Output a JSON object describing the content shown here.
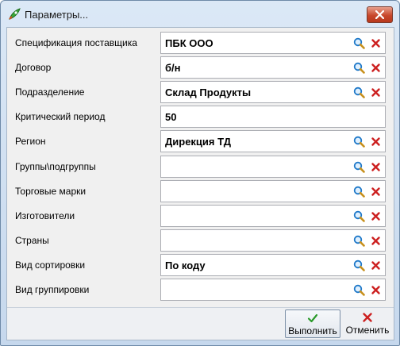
{
  "window": {
    "title": "Параметры...",
    "app_icon": "rocket-app-icon",
    "close_icon": "close-icon"
  },
  "params": [
    {
      "label": "Спецификация поставщика",
      "value": "ПБК ООО",
      "has_lookup": true
    },
    {
      "label": "Договор",
      "value": "б/н",
      "has_lookup": true
    },
    {
      "label": "Подразделение",
      "value": "Склад Продукты",
      "has_lookup": true
    },
    {
      "label": "Критический период",
      "value": "50",
      "has_lookup": false
    },
    {
      "label": "Регион",
      "value": "Дирекция ТД",
      "has_lookup": true
    },
    {
      "label": "Группы\\подгруппы",
      "value": "",
      "has_lookup": true
    },
    {
      "label": "Торговые марки",
      "value": "",
      "has_lookup": true
    },
    {
      "label": "Изготовители",
      "value": "",
      "has_lookup": true
    },
    {
      "label": "Страны",
      "value": "",
      "has_lookup": true
    },
    {
      "label": "Вид сортировки",
      "value": "По коду",
      "has_lookup": true
    },
    {
      "label": "Вид группировки",
      "value": "",
      "has_lookup": true
    }
  ],
  "footer": {
    "ok_label": "Выполнить",
    "cancel_label": "Отменить",
    "ok_icon": "checkmark-icon",
    "cancel_icon": "cross-icon"
  },
  "colors": {
    "search_icon": "#1e78c8",
    "clear_icon": "#cc2020",
    "ok_icon": "#2a9a2a",
    "title_bar": "#c6d8ed"
  }
}
